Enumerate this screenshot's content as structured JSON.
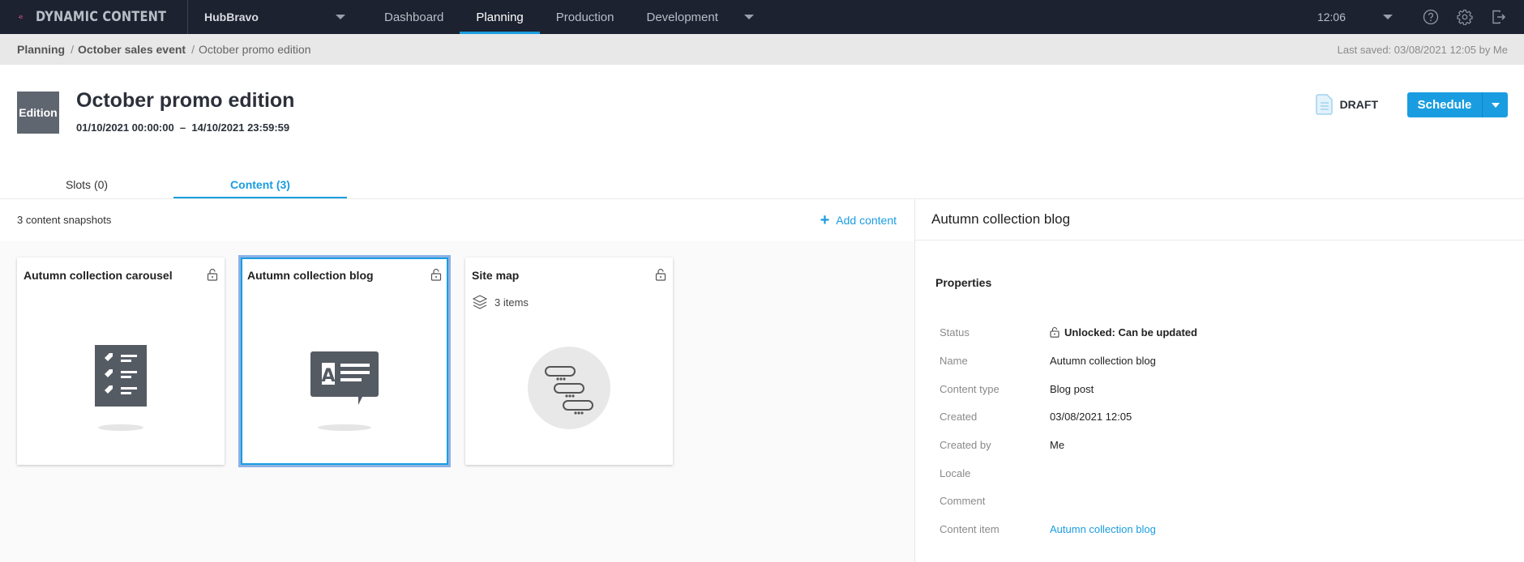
{
  "topbar": {
    "brand": "DYNAMIC CONTENT",
    "hub": "HubBravo",
    "nav": [
      {
        "label": "Dashboard",
        "active": false
      },
      {
        "label": "Planning",
        "active": true
      },
      {
        "label": "Production",
        "active": false
      },
      {
        "label": "Development",
        "active": false
      }
    ],
    "time": "12:06",
    "icons": [
      "help-icon",
      "gear-icon",
      "logout-icon"
    ]
  },
  "breadcrumb": {
    "items": [
      "Planning",
      "October sales event",
      "October promo edition"
    ],
    "last_saved": "Last saved: 03/08/2021 12:05 by Me"
  },
  "header": {
    "badge": "Edition",
    "title": "October promo edition",
    "dates": "01/10/2021 00:00:00  –  14/10/2021 23:59:59",
    "status": "DRAFT",
    "schedule_label": "Schedule"
  },
  "tabs": [
    {
      "label": "Slots (0)",
      "active": false
    },
    {
      "label": "Content (3)",
      "active": true
    }
  ],
  "content": {
    "count_label": "3 content snapshots",
    "add_label": "Add content",
    "cards": [
      {
        "title": "Autumn collection carousel",
        "icon": "carousel-icon",
        "selected": false,
        "locked": false
      },
      {
        "title": "Autumn collection blog",
        "icon": "blog-icon",
        "selected": true,
        "locked": false
      },
      {
        "title": "Site map",
        "icon": "hierarchy-icon",
        "meta": "3 items",
        "selected": false,
        "locked": false
      }
    ]
  },
  "details": {
    "title": "Autumn collection blog",
    "heading": "Properties",
    "properties": [
      {
        "label": "Status",
        "value": "Unlocked: Can be updated"
      },
      {
        "label": "Name",
        "value": "Autumn collection blog"
      },
      {
        "label": "Content type",
        "value": "Blog post"
      },
      {
        "label": "Created",
        "value": "03/08/2021 12:05"
      },
      {
        "label": "Created by",
        "value": "Me"
      },
      {
        "label": "Locale",
        "value": ""
      },
      {
        "label": "Comment",
        "value": ""
      },
      {
        "label": "Content item",
        "value": "Autumn collection blog"
      }
    ]
  },
  "colors": {
    "accent": "#1a9de0",
    "topbar": "#1c2230",
    "breadcrumb_bg": "#e8e8e8",
    "selected_outline": "#8cb2e6"
  }
}
